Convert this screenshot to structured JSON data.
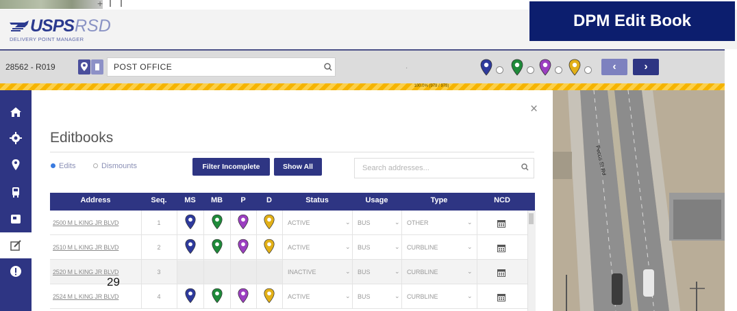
{
  "app": {
    "logo_main": "USPS",
    "logo_product": "RSD",
    "logo_subtitle": "DELIVERY POINT MANAGER",
    "slide_banner": "DPM Edit Book",
    "page_number": "29"
  },
  "toolbar": {
    "route_id": "28562 - R019",
    "search_value": "POST OFFICE",
    "progress_text": "100.0% (978 / 978)"
  },
  "legend": [
    {
      "name": "ms",
      "color": "#2e3a9c"
    },
    {
      "name": "mb",
      "color": "#1f8a3a"
    },
    {
      "name": "p",
      "color": "#9b3fc0"
    },
    {
      "name": "d",
      "color": "#e2b018"
    }
  ],
  "colors": {
    "navy": "#2e3583",
    "banner": "#0c1e6e",
    "progress": "#fbc324",
    "nav_prev": "#7d81bf",
    "nav_next": "#2e3583"
  },
  "panel": {
    "title": "Editbooks",
    "radio_edits": "Edits",
    "radio_dismounts": "Dismounts",
    "filter_button": "Filter Incomplete",
    "show_all_button": "Show All",
    "search_placeholder": "Search addresses...",
    "close_symbol": "×"
  },
  "table": {
    "headers": [
      "Address",
      "Seq.",
      "MS",
      "MB",
      "P",
      "D",
      "Status",
      "Usage",
      "Type",
      "NCD"
    ],
    "rows": [
      {
        "address": "2500 M L KING JR BLVD",
        "seq": "1",
        "status": "ACTIVE",
        "usage": "BUS",
        "type": "OTHER",
        "has_icons": true
      },
      {
        "address": "2510 M L KING JR BLVD",
        "seq": "2",
        "status": "ACTIVE",
        "usage": "BUS",
        "type": "CURBLINE",
        "has_icons": true
      },
      {
        "address": "2520 M L KING JR BLVD",
        "seq": "3",
        "status": "INACTIVE",
        "usage": "BUS",
        "type": "CURBLINE",
        "has_icons": false
      },
      {
        "address": "2524 M L KING JR BLVD",
        "seq": "4",
        "status": "ACTIVE",
        "usage": "BUS",
        "type": "CURBLINE",
        "has_icons": true
      }
    ]
  },
  "map": {
    "street_label": "Pecos St Rd"
  }
}
